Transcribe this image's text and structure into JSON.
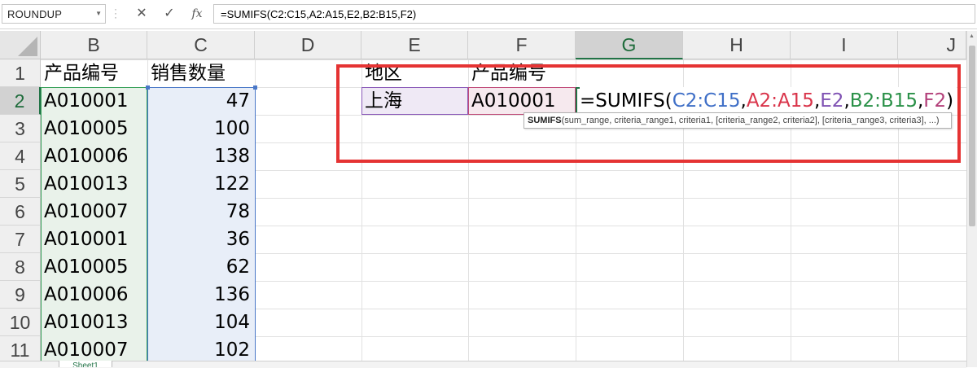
{
  "formula_bar": {
    "name_box": "ROUNDUP",
    "cancel_glyph": "✕",
    "enter_glyph": "✓",
    "fx_label": "fx",
    "formula": "=SUMIFS(C2:C15,A2:A15,E2,B2:B15,F2)"
  },
  "columns": [
    "B",
    "C",
    "D",
    "E",
    "F",
    "G",
    "H",
    "I",
    "J"
  ],
  "rows": [
    "1",
    "2",
    "3",
    "4",
    "5",
    "6",
    "7",
    "8",
    "9",
    "10",
    "11"
  ],
  "sheet": {
    "header_b": "产品编号",
    "header_c": "销售数量",
    "table": [
      {
        "code": "A010001",
        "qty": "47"
      },
      {
        "code": "A010005",
        "qty": "100"
      },
      {
        "code": "A010006",
        "qty": "138"
      },
      {
        "code": "A010013",
        "qty": "122"
      },
      {
        "code": "A010007",
        "qty": "78"
      },
      {
        "code": "A010001",
        "qty": "36"
      },
      {
        "code": "A010005",
        "qty": "62"
      },
      {
        "code": "A010006",
        "qty": "136"
      },
      {
        "code": "A010013",
        "qty": "104"
      },
      {
        "code": "A010007",
        "qty": "102"
      }
    ],
    "e1": "地区",
    "f1": "产品编号",
    "e2": "上海",
    "f2": "A010001"
  },
  "edit": {
    "parts": [
      {
        "text": "=SUMIFS(",
        "color": "#000000"
      },
      {
        "text": "C2:C15",
        "color": "#3f6fc7"
      },
      {
        "text": ",",
        "color": "#000000"
      },
      {
        "text": "A2:A15",
        "color": "#d9344a"
      },
      {
        "text": ",",
        "color": "#000000"
      },
      {
        "text": "E2",
        "color": "#7f52b3"
      },
      {
        "text": ",",
        "color": "#000000"
      },
      {
        "text": "B2:B15",
        "color": "#2a9148"
      },
      {
        "text": ",",
        "color": "#000000"
      },
      {
        "text": "F2",
        "color": "#b3407a"
      },
      {
        "text": ")",
        "color": "#000000"
      }
    ]
  },
  "tooltip": {
    "fn": "SUMIFS",
    "args": "(sum_range, criteria_range1, criteria1, [criteria_range2, criteria2], [criteria_range3, criteria3], ...)"
  },
  "sheet_tab": "Sheet1",
  "colors": {
    "accent": "#217346",
    "highlight_box": "#e53333"
  }
}
